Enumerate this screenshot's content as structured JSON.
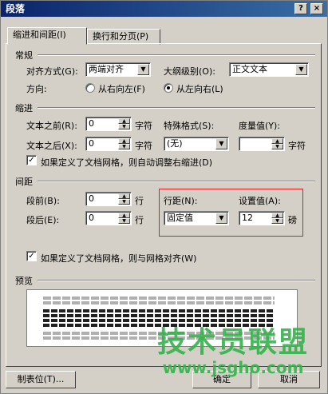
{
  "window": {
    "title": "段落",
    "help_button": "?",
    "close_button": "×"
  },
  "tabs": [
    {
      "label": "缩进和间距(I)",
      "active": true
    },
    {
      "label": "换行和分页(P)",
      "active": false
    }
  ],
  "general": {
    "group_label": "常规",
    "alignment_label": "对齐方式(G):",
    "alignment_value": "两端对齐",
    "outline_label": "大纲级别(O):",
    "outline_value": "正文文本",
    "direction_label": "方向:",
    "rtl_label": "从右向左(F)",
    "ltr_label": "从左向右(L)",
    "direction_selected": "ltr"
  },
  "indent": {
    "group_label": "缩进",
    "before_label": "文本之前(R):",
    "before_value": "0",
    "before_unit": "字符",
    "after_label": "文本之后(X):",
    "after_value": "0",
    "after_unit": "字符",
    "special_label": "特殊格式(S):",
    "special_value": "(无)",
    "measure_label": "度量值(Y):",
    "measure_value": "",
    "measure_unit": "字符",
    "auto_adjust_label": "如果定义了文档网格，则自动调整右缩进(D)",
    "auto_adjust_checked": true
  },
  "spacing": {
    "group_label": "间距",
    "before_label": "段前(B):",
    "before_value": "0",
    "before_unit": "行",
    "after_label": "段后(E):",
    "after_value": "0",
    "after_unit": "行",
    "line_spacing_label": "行距(N):",
    "line_spacing_value": "固定值",
    "setting_label": "设置值(A):",
    "setting_value": "12",
    "setting_unit": "磅",
    "snap_grid_label": "如果定义了文档网格，则与网格对齐(W)",
    "snap_grid_checked": true
  },
  "preview": {
    "group_label": "预览"
  },
  "footer": {
    "tabs_button": "制表位(T)...",
    "ok_button": "确定",
    "cancel_button": "取消"
  },
  "watermark": {
    "brand": "技术员联盟",
    "site": "www.jsgho.com"
  },
  "colors": {
    "highlight_box": "#e02020",
    "watermark": "#34b34a",
    "titlebar": "#0a246a"
  }
}
